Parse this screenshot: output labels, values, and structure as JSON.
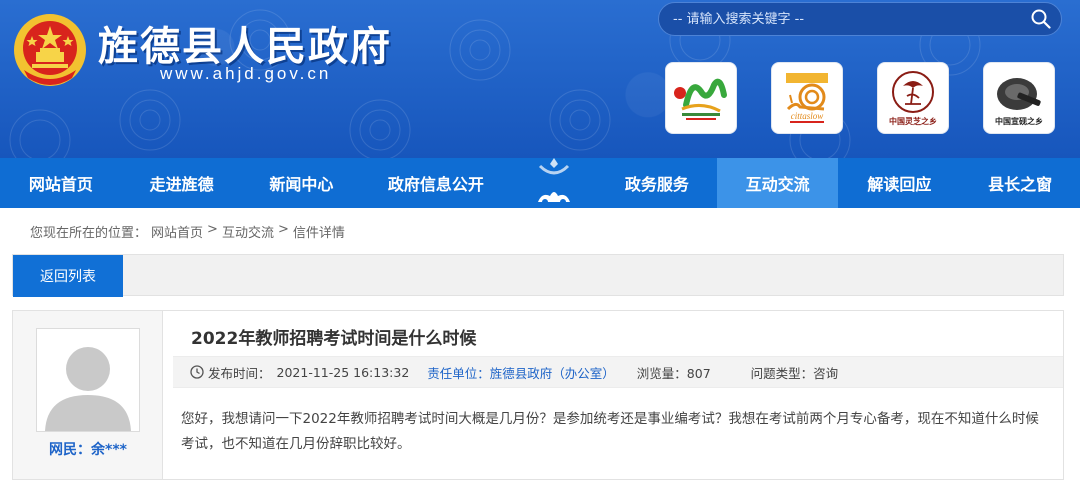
{
  "header": {
    "site_title": "旌德县人民政府",
    "site_url": "www.ahjd.gov.cn",
    "search_placeholder": "-- 请输入搜索关键字 --",
    "badges": [
      {
        "name": "badge-tourism",
        "caption": ""
      },
      {
        "name": "badge-cittaslow",
        "caption": "cittaslow"
      },
      {
        "name": "badge-lingzhi",
        "caption": "中国灵芝之乡"
      },
      {
        "name": "badge-inkstone",
        "caption": "中国宣砚之乡"
      }
    ]
  },
  "nav": {
    "items": [
      "网站首页",
      "走进旌德",
      "新闻中心",
      "政府信息公开",
      "政务服务",
      "互动交流",
      "解读回应",
      "县长之窗"
    ],
    "active_index": 5
  },
  "breadcrumb": {
    "prefix": "您现在所在的位置：",
    "items": [
      "网站首页",
      "互动交流",
      "信件详情"
    ],
    "separator": ">"
  },
  "back_button": "返回列表",
  "letter": {
    "author": "网民：余***",
    "title": "2022年教师招聘考试时间是什么时候",
    "publish_label": "发布时间：",
    "publish_time": "2021-11-25 16:13:32",
    "unit_text": "责任单位：旌德县政府（办公室）",
    "views_text": "浏览量：807",
    "type_text": "问题类型：咨询",
    "content": "您好，我想请问一下2022年教师招聘考试时间大概是几月份？是参加统考还是事业编考试？我想在考试前两个月专心备考，现在不知道什么时候考试，也不知道在几月份辞职比较好。"
  },
  "colors": {
    "header_bg": "#1b5ec4",
    "nav_bg": "#0f6dd3",
    "nav_active": "#3c93e8",
    "accent_blue": "#1170d6",
    "link_blue": "#1e64c8"
  }
}
